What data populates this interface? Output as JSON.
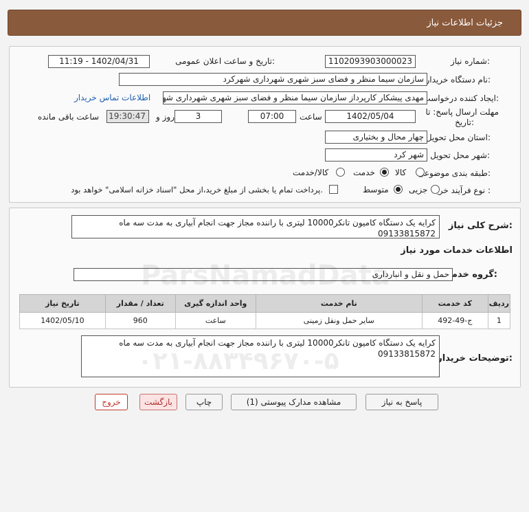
{
  "header": {
    "title": "جزئیات اطلاعات نیاز"
  },
  "form": {
    "need_number_label": "شماره نیاز:",
    "need_number": "1102093903000023",
    "announce_label": "تاریخ و ساعت اعلان عمومی:",
    "announce_value": "1402/04/31 - 11:19",
    "buyer_org_label": "نام دستگاه خریدار:",
    "buyer_org": "سازمان سیما منظر و فضای سبز شهری شهرداری شهرکرد",
    "creator_label": "ایجاد کننده درخواست:",
    "creator": "مهدی پیشکار کارپرداز سازمان سیما منظر و فضای سبز شهری شهرداری شهرکرد",
    "contact_link": "اطلاعات تماس خریدار",
    "deadline_label": "مهلت ارسال پاسخ: تا",
    "deadline_label2": "تاریخ:",
    "deadline_date": "1402/05/04",
    "time_label": "ساعت",
    "deadline_time": "07:00",
    "days": "3",
    "days_label": "روز و",
    "remaining_time": "19:30:47",
    "remaining_label": "ساعت باقی مانده",
    "province_label": "استان محل تحویل:",
    "province": "چهار محال و بختیاری",
    "city_label": "شهر محل تحویل:",
    "city": "شهر کرد",
    "category_label": "طبقه بندی موضوعی:",
    "category_options": [
      "کالا",
      "خدمت",
      "کالا/خدمت"
    ],
    "process_label": "نوع فرآیند خرید :",
    "process_options": [
      "جزیی",
      "متوسط"
    ],
    "payment_note": "پرداخت تمام یا بخشی از مبلغ خرید،از محل \"اسناد خزانه اسلامی\" خواهد بود."
  },
  "description": {
    "label": "شرح کلی نیاز:",
    "line1": "کرایه یک دستگاه کامیون تانکر10000 لیتری با راننده مجاز جهت انجام آبیاری به مدت سه ماه",
    "line2": "09133815872"
  },
  "services": {
    "section_title": "اطلاعات خدمات مورد نیاز",
    "group_label": "گروه خدمت:",
    "group_value": "حمل و نقل و انبارداری",
    "columns": [
      "ردیف",
      "کد خدمت",
      "نام خدمت",
      "واحد اندازه گیری",
      "تعداد / مقدار",
      "تاریخ نیاز"
    ],
    "rows": [
      [
        "1",
        "ج-49-492",
        "سایر حمل ونقل زمینی",
        "ساعت",
        "960",
        "1402/05/10"
      ]
    ]
  },
  "buyer_notes": {
    "label": "توضیحات خریدار:",
    "line1": "کرایه یک دستگاه کامیون تانکر10000 لیتری با راننده مجاز جهت انجام آبیاری به مدت سه ماه",
    "line2": "09133815872"
  },
  "buttons": {
    "reply": "پاسخ به نیاز",
    "attachments": "مشاهده مدارک پیوستی (1)",
    "print": "چاپ",
    "back": "بازگشت",
    "exit": "خروج"
  },
  "watermark": {
    "brand": "ParsNamadData",
    "phone": "۰۲۱-۸۸۳۴۹۶۷۰-۵"
  }
}
